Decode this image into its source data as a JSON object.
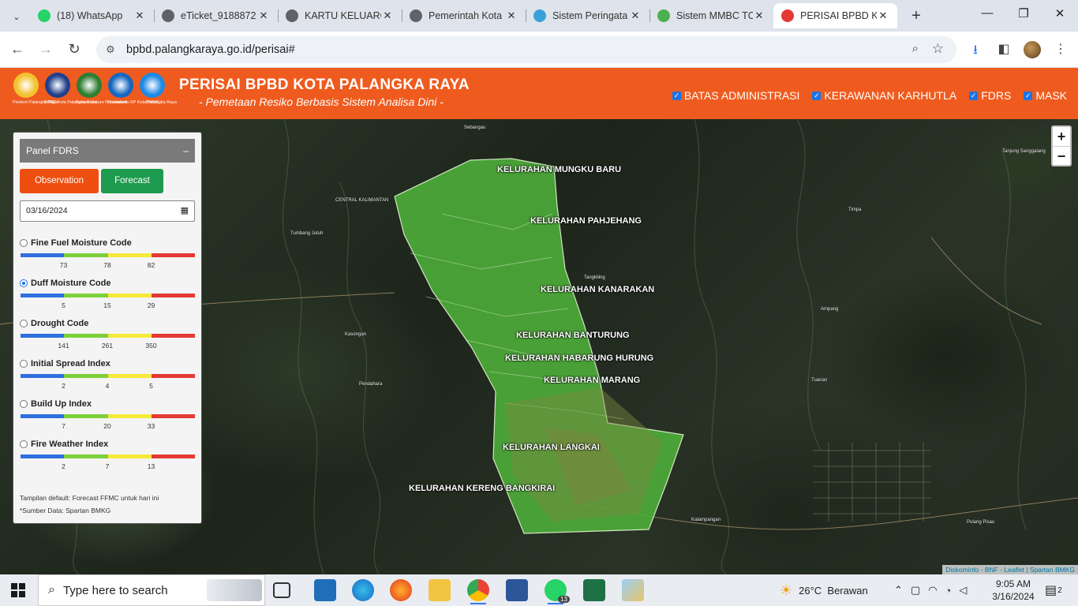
{
  "browser": {
    "tabs": [
      {
        "title": "(18) WhatsApp",
        "icon": "whatsapp-icon",
        "color": "#25d366"
      },
      {
        "title": "eTicket_9188872",
        "icon": "globe-icon",
        "color": "#5f6368"
      },
      {
        "title": "KARTU KELUARG",
        "icon": "globe-icon",
        "color": "#5f6368"
      },
      {
        "title": "Pemerintah Kota",
        "icon": "globe-icon",
        "color": "#5f6368"
      },
      {
        "title": "Sistem Peringata",
        "icon": "bmkg-icon",
        "color": "#3aa0d8"
      },
      {
        "title": "Sistem MMBC TC",
        "icon": "mmbc-icon",
        "color": "#4caf50"
      },
      {
        "title": "PERISAI BPBD Ko",
        "icon": "bpbd-icon",
        "color": "#e53935"
      }
    ],
    "url": "bpbd.palangkaraya.go.id/perisai#"
  },
  "site": {
    "title": "PERISAI BPBD KOTA PALANGKA RAYA",
    "subtitle": "- Pemetaan Resiko Berbasis Sistem Analisa Dini -",
    "logos": [
      {
        "caption": "Pemkot Palangka Raya",
        "color": "#f2c230"
      },
      {
        "caption": "BPBD Kota Palangka Raya",
        "color": "#1f3f8a"
      },
      {
        "caption": "Borneo Nature Foundation",
        "color": "#2e7d32"
      },
      {
        "caption": "Diskominfo-SP Kota Palangka Raya",
        "color": "#1565c0"
      },
      {
        "caption": "BMKG",
        "color": "#1e88e5"
      }
    ],
    "layers": [
      "BATAS ADMINISTRASI",
      "KERAWANAN KARHUTLA",
      "FDRS",
      "MASK"
    ]
  },
  "panel": {
    "title": "Panel FDRS",
    "minimize": "–",
    "observation_label": "Observation",
    "forecast_label": "Forecast",
    "date_value": "03/16/2024",
    "indices": [
      {
        "label": "Fine Fuel Moisture Code",
        "selected": false,
        "ticks": [
          "73",
          "78",
          "82"
        ]
      },
      {
        "label": "Duff Moisture Code",
        "selected": true,
        "ticks": [
          "5",
          "15",
          "29"
        ]
      },
      {
        "label": "Drought Code",
        "selected": false,
        "ticks": [
          "141",
          "261",
          "350"
        ]
      },
      {
        "label": "Initial Spread Index",
        "selected": false,
        "ticks": [
          "2",
          "4",
          "5"
        ]
      },
      {
        "label": "Build Up Index",
        "selected": false,
        "ticks": [
          "7",
          "20",
          "33"
        ]
      },
      {
        "label": "Fire Weather Index",
        "selected": false,
        "ticks": [
          "2",
          "7",
          "13"
        ]
      }
    ],
    "scale_colors": [
      "#2f6fe0",
      "#7ed03a",
      "#f6e93a",
      "#e53935"
    ],
    "note_default": "Tampilan default: Forecast FFMC untuk hari ini",
    "note_source": "*Sumber Data: Spartan BMKG"
  },
  "map": {
    "kelurahan": [
      "KELURAHAN MUNGKU BARU",
      "KELURAHAN PAHJEHANG",
      "KELURAHAN KANARAKAN",
      "KELURAHAN BANTURUNG",
      "KELURAHAN HABARUNG HURUNG",
      "KELURAHAN MARANG",
      "KELURAHAN LANGKAI",
      "KELURAHAN KERENG BANGKIRAI"
    ],
    "towns": [
      "Sebangau",
      "CENTRAL KALIMANTAN",
      "Tumbang Jutuh",
      "Tanjung Sanggalang",
      "Timpa",
      "Ampang",
      "Tangkiling",
      "Kasongan",
      "Pendahara",
      "Tuanan",
      "Kalampangan",
      "Pulang Pisau"
    ],
    "zoom_in": "+",
    "zoom_out": "−",
    "attribution": "Diskominfo - BNF - Leaflet | Spartan BMKG"
  },
  "taskbar": {
    "search_placeholder": "Type here to search",
    "weather": "26°C  Berawan",
    "time": "9:05 AM",
    "date": "3/16/2024",
    "notifications": "2",
    "whatsapp_badge": "13"
  }
}
